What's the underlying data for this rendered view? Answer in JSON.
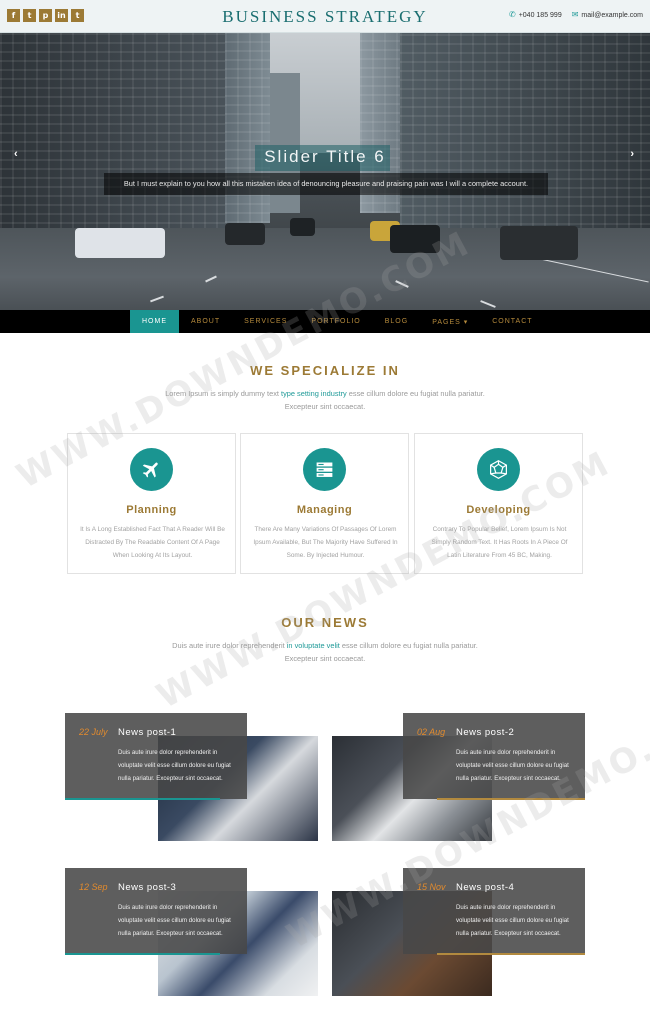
{
  "header": {
    "brand": "BUSINESS STRATEGY",
    "socials": [
      {
        "icon": "facebook-icon",
        "glyph": "f"
      },
      {
        "icon": "twitter-icon",
        "glyph": "t"
      },
      {
        "icon": "pinterest-icon",
        "glyph": "p"
      },
      {
        "icon": "linkedin-icon",
        "glyph": "in"
      },
      {
        "icon": "tumblr-icon",
        "glyph": "t"
      }
    ],
    "phone": "+040 185 999",
    "email": "mail@example.com"
  },
  "slider": {
    "title": "Slider Title 6",
    "description": "But I must explain to you how all this mistaken idea of denouncing pleasure and praising pain was I will a complete account.",
    "prev": "‹",
    "next": "›"
  },
  "nav": {
    "items": [
      "HOME",
      "ABOUT",
      "SERVICES",
      "PORTFOLIO",
      "BLOG",
      "PAGES ▾",
      "CONTACT"
    ],
    "active_index": 0
  },
  "specialize": {
    "title": "WE SPECIALIZE IN",
    "sub_before": "Lorem Ipsum is simply dummy text ",
    "sub_highlight": "type setting industry",
    "sub_after": " esse cillum dolore eu fugiat nulla pariatur.",
    "sub_line2": "Excepteur sint occaecat.",
    "cards": [
      {
        "title": "Planning",
        "icon": "airplane-icon",
        "text": "It Is A Long Established Fact That A Reader Will Be Distracted By The Readable Content Of A Page When Looking At Its Layout."
      },
      {
        "title": "Managing",
        "icon": "server-icon",
        "text": "There Are Many Variations Of Passages Of Lorem Ipsum Available, But The Majority Have Suffered In Some. By Injected Humour."
      },
      {
        "title": "Developing",
        "icon": "polygon-icon",
        "text": "Contrary To Popular Belief, Lorem Ipsum Is Not Simply Random Text. It Has Roots In A Piece Of Latin Literature From 45 BC, Making."
      }
    ]
  },
  "news": {
    "title": "OUR NEWS",
    "sub_before": "Duis aute irure dolor reprehenderit ",
    "sub_highlight": "in voluptate velit",
    "sub_after": " esse cillum dolore eu fugiat nulla pariatur.",
    "sub_line2": "Excepteur sint occaecat.",
    "posts": [
      {
        "date": "22 July",
        "title": "News post-1",
        "text": "Duis aute irure dolor reprehenderit in voluptate velit esse cillum dolore eu fugiat nulla pariatur. Excepteur sint occaecat."
      },
      {
        "date": "02 Aug",
        "title": "News post-2",
        "text": "Duis aute irure dolor reprehenderit in voluptate velit esse cillum dolore eu fugiat nulla pariatur. Excepteur sint occaecat."
      },
      {
        "date": "12 Sep",
        "title": "News post-3",
        "text": "Duis aute irure dolor reprehenderit in voluptate velit esse cillum dolore eu fugiat nulla pariatur. Excepteur sint occaecat."
      },
      {
        "date": "15 Nov",
        "title": "News post-4",
        "text": "Duis aute irure dolor reprehenderit in voluptate velit esse cillum dolore eu fugiat nulla pariatur. Excepteur sint occaecat."
      }
    ]
  },
  "watermark": "WWW.DOWNDEMO.COM",
  "colors": {
    "accent": "#1a9591",
    "gold": "#9c7a35",
    "date": "#e08a2e"
  }
}
